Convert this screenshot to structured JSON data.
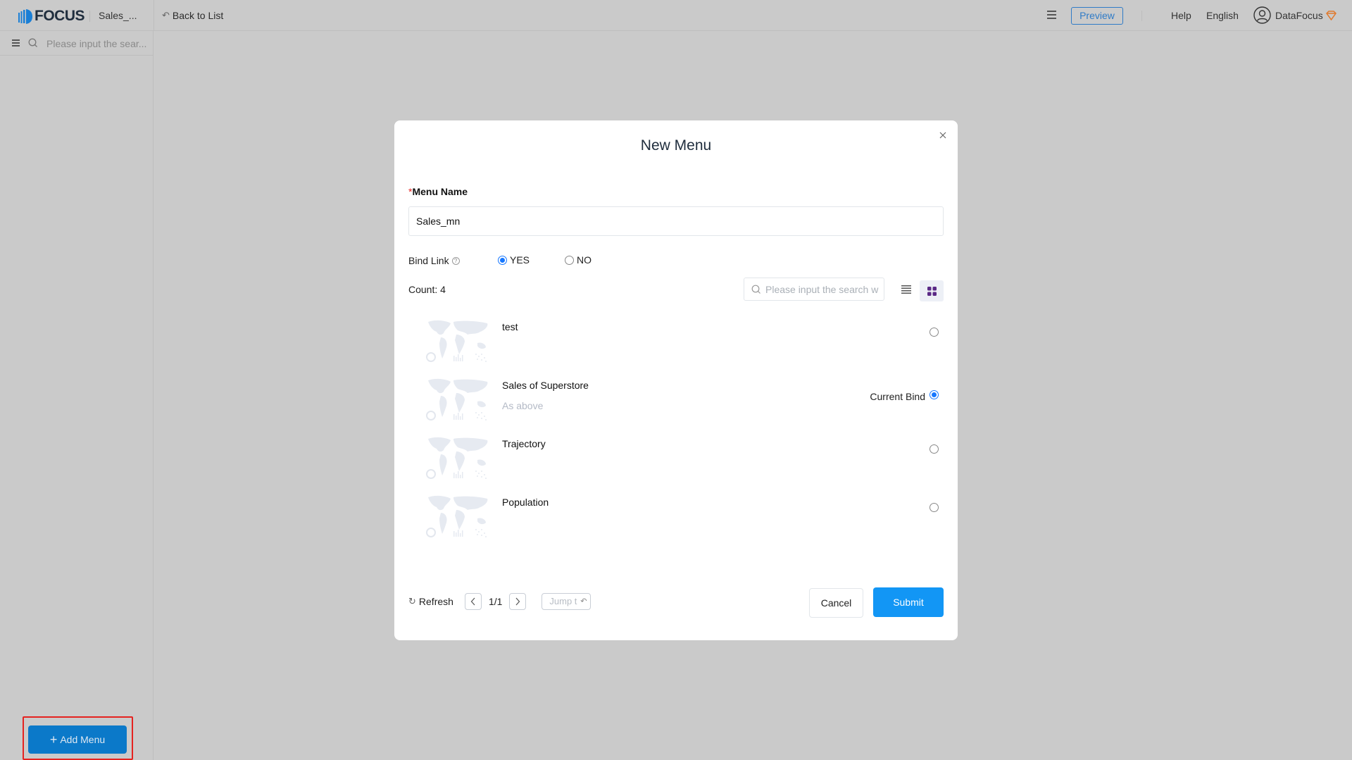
{
  "header": {
    "logo_text": "FOCUS",
    "app_name": "Sales_...",
    "back_label": "Back to List",
    "preview_label": "Preview",
    "help_label": "Help",
    "language_label": "English",
    "user_name": "DataFocus"
  },
  "sidebar": {
    "search_placeholder": "Please input the sear...",
    "add_menu_label": "Add Menu"
  },
  "modal": {
    "title": "New Menu",
    "menu_name_label": "Menu Name",
    "required_mark": "*",
    "menu_name_value": "Sales_mn",
    "bind_link_label": "Bind Link",
    "bind_link_options": [
      {
        "label": "YES",
        "checked": true
      },
      {
        "label": "NO",
        "checked": false
      }
    ],
    "count_label": "Count: 4",
    "list_search_placeholder": "Please input the search w",
    "items": [
      {
        "name": "test",
        "description": "",
        "selected": false,
        "status": ""
      },
      {
        "name": "Sales of Superstore",
        "description": "As above",
        "selected": true,
        "status": "Current Bind"
      },
      {
        "name": "Trajectory",
        "description": "",
        "selected": false,
        "status": ""
      },
      {
        "name": "Population",
        "description": "",
        "selected": false,
        "status": ""
      }
    ],
    "refresh_label": "Refresh",
    "page_indicator": "1/1",
    "jump_placeholder": "Jump t",
    "cancel_label": "Cancel",
    "submit_label": "Submit"
  },
  "colors": {
    "primary": "#1296f5",
    "add_button": "#0b79c9",
    "highlight_frame": "#e5221f",
    "radio_checked": "#1677ff",
    "grid_view_icon": "#5b2a86"
  }
}
